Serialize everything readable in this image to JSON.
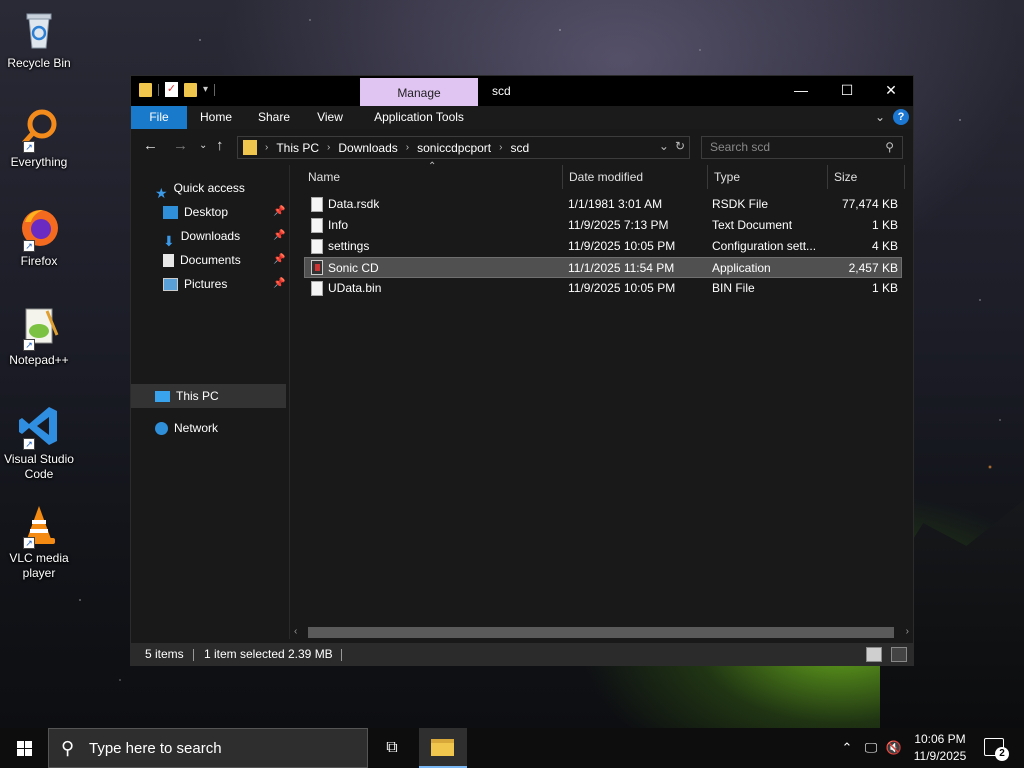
{
  "desktop": {
    "icons": [
      {
        "label": "Recycle Bin"
      },
      {
        "label": "Everything"
      },
      {
        "label": "Firefox"
      },
      {
        "label": "Notepad++"
      },
      {
        "label": "Visual Studio Code"
      },
      {
        "label": "VLC media player"
      }
    ]
  },
  "window": {
    "title": "scd",
    "contextual_tab": "Manage",
    "controls": {
      "minimize": "—",
      "maximize": "☐",
      "close": "✕"
    },
    "ribbon_tabs": [
      "File",
      "Home",
      "Share",
      "View",
      "Application Tools"
    ],
    "address": {
      "crumbs": [
        "This PC",
        "Downloads",
        "soniccdpcport",
        "scd"
      ]
    },
    "search": {
      "placeholder": "Search scd"
    },
    "nav": {
      "quick_access": "Quick access",
      "pinned": [
        "Desktop",
        "Downloads",
        "Documents",
        "Pictures"
      ],
      "this_pc": "This PC",
      "network": "Network"
    },
    "columns": [
      "Name",
      "Date modified",
      "Type",
      "Size"
    ],
    "files": [
      {
        "name": "Data.rsdk",
        "date": "1/1/1981 3:01 AM",
        "type": "RSDK File",
        "size": "77,474 KB",
        "icon": "file-icon",
        "selected": false
      },
      {
        "name": "Info",
        "date": "11/9/2025 7:13 PM",
        "type": "Text Document",
        "size": "1 KB",
        "icon": "file-icon",
        "selected": false
      },
      {
        "name": "settings",
        "date": "11/9/2025 10:05 PM",
        "type": "Configuration sett...",
        "size": "4 KB",
        "icon": "file-icon",
        "selected": false
      },
      {
        "name": "Sonic CD",
        "date": "11/1/2025 11:54 PM",
        "type": "Application",
        "size": "2,457 KB",
        "icon": "app-icon",
        "selected": true
      },
      {
        "name": "UData.bin",
        "date": "11/9/2025 10:05 PM",
        "type": "BIN File",
        "size": "1 KB",
        "icon": "file-icon",
        "selected": false
      }
    ],
    "status": {
      "items": "5 items",
      "selected": "1 item selected",
      "size": "2.39 MB"
    }
  },
  "taskbar": {
    "search_placeholder": "Type here to search",
    "time": "10:06 PM",
    "date": "11/9/2025",
    "notification_count": "2"
  }
}
